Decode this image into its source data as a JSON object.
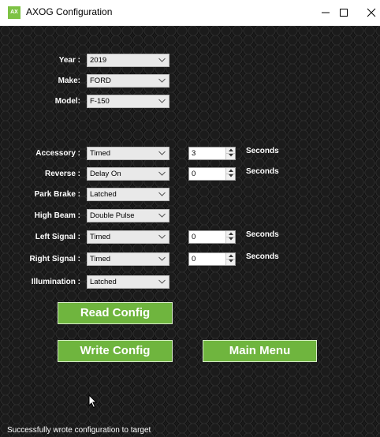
{
  "window": {
    "title": "AXOG Configuration",
    "icon_text": "AX",
    "accent_color": "#6fb53e"
  },
  "vehicle": {
    "year": {
      "label": "Year :",
      "value": "2019"
    },
    "make": {
      "label": "Make:",
      "value": "FORD"
    },
    "model": {
      "label": "Model:",
      "value": "F-150"
    }
  },
  "config": [
    {
      "label": "Accessory :",
      "mode": "Timed",
      "seconds": "3",
      "unit": "Seconds"
    },
    {
      "label": "Reverse :",
      "mode": "Delay On",
      "seconds": "0",
      "unit": "Seconds"
    },
    {
      "label": "Park Brake :",
      "mode": "Latched"
    },
    {
      "label": "High Beam :",
      "mode": "Double Pulse"
    },
    {
      "label": "Left Signal :",
      "mode": "Timed",
      "seconds": "0",
      "unit": "Seconds"
    },
    {
      "label": "Right Signal :",
      "mode": "Timed",
      "seconds": "0",
      "unit": "Seconds"
    },
    {
      "label": "Illumination :",
      "mode": "Latched"
    }
  ],
  "buttons": {
    "read": "Read Config",
    "write": "Write Config",
    "main_menu": "Main Menu"
  },
  "status": "Successfully wrote configuration to target"
}
